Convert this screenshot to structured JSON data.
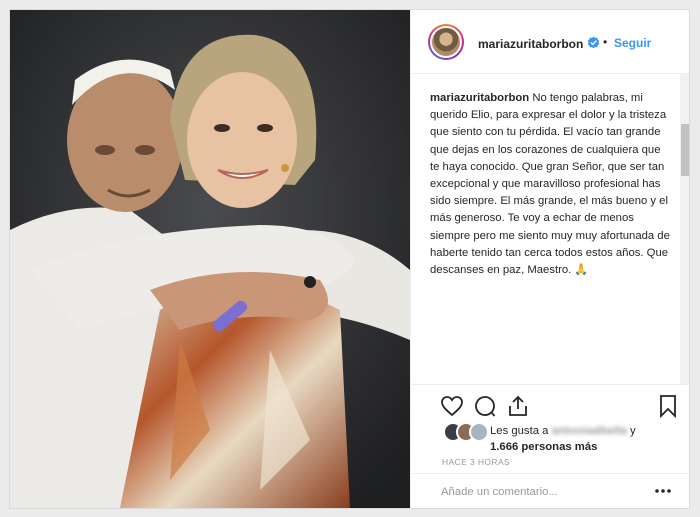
{
  "post": {
    "username": "mariazuritaborbon",
    "follow_label": "Seguir",
    "separator": "•",
    "caption_user": "mariazuritaborbon",
    "caption_text": "No tengo palabras, mi querido Elio, para expresar el dolor y la tristeza que siento con tu pérdida. El vacío tan grande que dejas en los corazones de cualquiera que te haya conocido. Que gran Señor, que ser tan excepcional y que maravilloso profesional has sido siempre. El más grande, el más bueno y el más generoso. Te voy a echar de menos siempre pero me siento muy muy afortunada de haberte tenido tan cerca todos estos años. Que descanses en paz, Maestro. 🙏",
    "likes_prefix": "Les gusta a",
    "likes_user": "antoniaalbella",
    "likes_joiner": "y",
    "likes_count": "1.666 personas más",
    "timestamp": "HACE 3 HORAS",
    "comment_placeholder": "Añade un comentario..."
  },
  "icons": {
    "verified": "verified-badge-icon",
    "like": "heart-icon",
    "comment": "comment-bubble-icon",
    "share": "share-icon",
    "save": "bookmark-icon",
    "more": "more-options-icon"
  },
  "colors": {
    "accent": "#3897f0",
    "text": "#262626",
    "muted": "#999999",
    "border": "#dbdbdb",
    "background": "#ebebeb"
  }
}
